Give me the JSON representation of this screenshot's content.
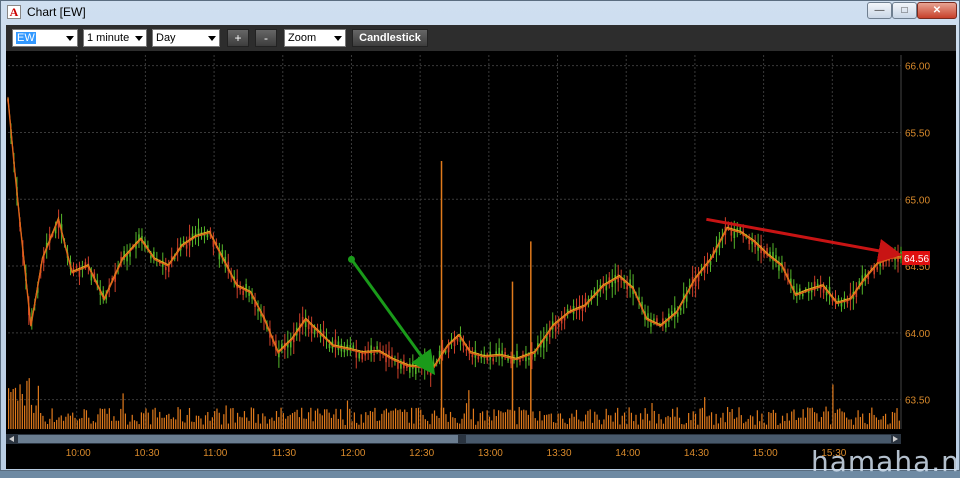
{
  "window": {
    "title": "Chart [EW]",
    "app_icon_letter": "A",
    "minimize_icon": "minimize-icon",
    "maximize_icon": "maximize-icon",
    "close_icon": "close-icon",
    "minimize_glyph": "—",
    "maximize_glyph": "□",
    "close_glyph": "✕"
  },
  "toolbar": {
    "symbol": "EW",
    "interval": "1 minute",
    "period": "Day",
    "zoom_in": "+",
    "zoom_out": "-",
    "zoom": "Zoom",
    "chart_style": "Candlestick"
  },
  "chart_data": {
    "type": "line",
    "series": [
      {
        "name": "",
        "values": []
      }
    ],
    "y_ticks": [
      "66.00",
      "65.50",
      "65.00",
      "64.50",
      "64.00",
      "63.50"
    ],
    "ylim": [
      63.28,
      66.08
    ],
    "x_ticks": [
      "10:00",
      "10:30",
      "11:00",
      "11:30",
      "12:00",
      "12:30",
      "13:00",
      "13:30",
      "14:00",
      "14:30",
      "15:00",
      "15:30"
    ],
    "x_range": [
      "09:30",
      "16:00"
    ],
    "last_price_label": "64.56",
    "last_price": 64.56,
    "grid": true,
    "price_path": [
      [
        "09:30",
        65.75
      ],
      [
        "09:33",
        65.2
      ],
      [
        "09:36",
        64.7
      ],
      [
        "09:40",
        64.05
      ],
      [
        "09:45",
        64.55
      ],
      [
        "09:52",
        64.85
      ],
      [
        "09:58",
        64.45
      ],
      [
        "10:05",
        64.5
      ],
      [
        "10:12",
        64.25
      ],
      [
        "10:20",
        64.55
      ],
      [
        "10:28",
        64.7
      ],
      [
        "10:34",
        64.55
      ],
      [
        "10:40",
        64.5
      ],
      [
        "10:46",
        64.65
      ],
      [
        "10:52",
        64.72
      ],
      [
        "10:58",
        64.75
      ],
      [
        "11:04",
        64.55
      ],
      [
        "11:10",
        64.35
      ],
      [
        "11:16",
        64.3
      ],
      [
        "11:22",
        64.1
      ],
      [
        "11:28",
        63.85
      ],
      [
        "11:34",
        63.95
      ],
      [
        "11:40",
        64.1
      ],
      [
        "11:46",
        64.0
      ],
      [
        "11:52",
        63.9
      ],
      [
        "11:58",
        63.88
      ],
      [
        "12:05",
        63.85
      ],
      [
        "12:12",
        63.86
      ],
      [
        "12:18",
        63.8
      ],
      [
        "12:25",
        63.75
      ],
      [
        "12:32",
        63.74
      ],
      [
        "12:36",
        63.74
      ],
      [
        "12:42",
        63.9
      ],
      [
        "12:47",
        63.98
      ],
      [
        "12:52",
        63.85
      ],
      [
        "12:58",
        63.82
      ],
      [
        "13:05",
        63.83
      ],
      [
        "13:12",
        63.8
      ],
      [
        "13:20",
        63.85
      ],
      [
        "13:28",
        64.05
      ],
      [
        "13:35",
        64.15
      ],
      [
        "13:42",
        64.2
      ],
      [
        "13:50",
        64.35
      ],
      [
        "13:57",
        64.42
      ],
      [
        "14:03",
        64.33
      ],
      [
        "14:09",
        64.1
      ],
      [
        "14:15",
        64.05
      ],
      [
        "14:22",
        64.15
      ],
      [
        "14:30",
        64.4
      ],
      [
        "14:37",
        64.55
      ],
      [
        "14:44",
        64.78
      ],
      [
        "14:50",
        64.75
      ],
      [
        "14:56",
        64.68
      ],
      [
        "15:02",
        64.58
      ],
      [
        "15:08",
        64.5
      ],
      [
        "15:14",
        64.28
      ],
      [
        "15:20",
        64.32
      ],
      [
        "15:26",
        64.35
      ],
      [
        "15:32",
        64.22
      ],
      [
        "15:38",
        64.25
      ],
      [
        "15:44",
        64.4
      ],
      [
        "15:50",
        64.52
      ],
      [
        "15:56",
        64.56
      ]
    ],
    "volume_spikes": [
      [
        "12:39",
        1.0
      ],
      [
        "13:10",
        0.55
      ],
      [
        "13:18",
        0.7
      ]
    ],
    "annotations": [
      {
        "name": "green-arrow",
        "color": "#1a9a1a",
        "from": [
          "12:00",
          64.55
        ],
        "to": [
          "12:35",
          63.72
        ]
      },
      {
        "name": "red-arrow",
        "color": "#c81414",
        "from": [
          "14:35",
          64.85
        ],
        "to": [
          "15:58",
          64.59
        ]
      }
    ]
  },
  "colors": {
    "background": "#000000",
    "grid": "#3a3a3a",
    "axis_text": "#d98a2b",
    "ma_line": "#e0621a",
    "ma_line2": "#e8b020",
    "volume": "#e07a1c",
    "candle_up": "#55b62a",
    "candle_down": "#d0402a",
    "last_price_box": "#e01010"
  },
  "watermark": "hamaha.net"
}
